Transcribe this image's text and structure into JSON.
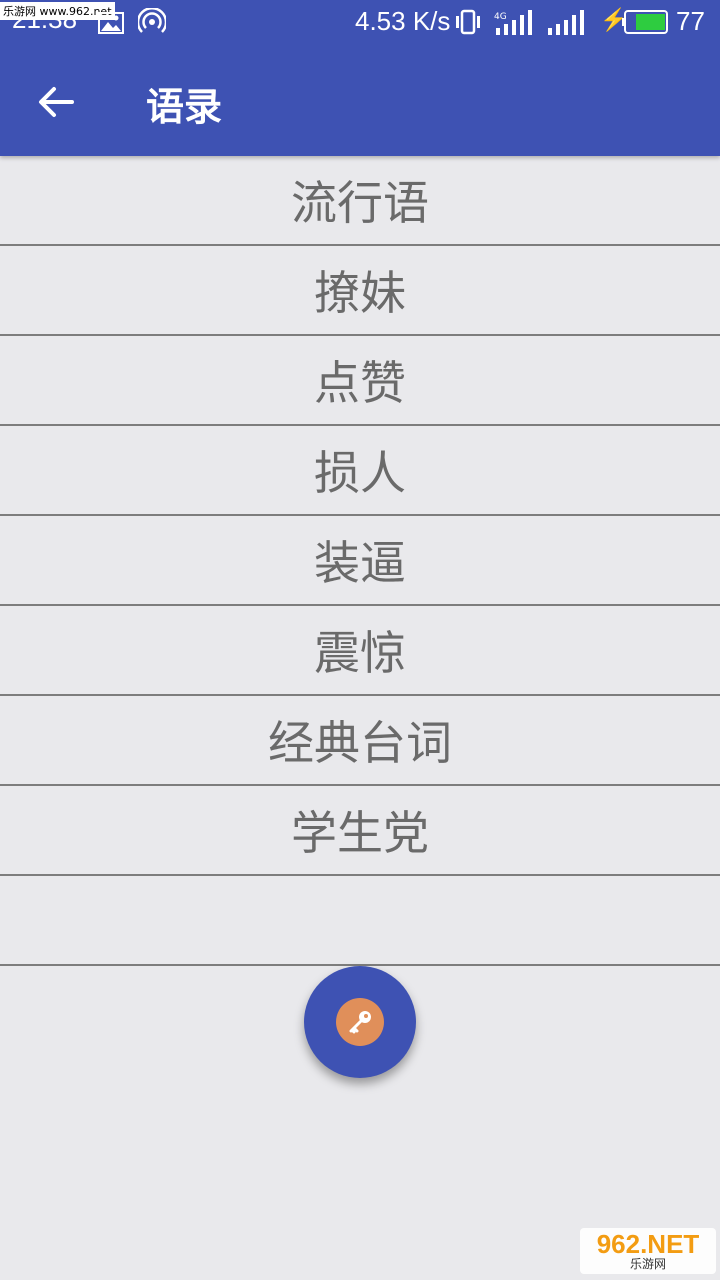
{
  "status_bar": {
    "time": "21:38",
    "watermark_top": "乐游网 www.962.net",
    "speed": "4.53 K/s",
    "network_type": "4G",
    "battery_level": "77",
    "colors": {
      "battery_fill": "#2ecc40"
    }
  },
  "app_bar": {
    "title": "语录",
    "back_icon": "arrow-left-icon",
    "colors": {
      "background": "#3e52b3"
    }
  },
  "list": {
    "items": [
      {
        "label": "流行语"
      },
      {
        "label": "撩妹"
      },
      {
        "label": "点赞"
      },
      {
        "label": "损人"
      },
      {
        "label": "装逼"
      },
      {
        "label": "震惊"
      },
      {
        "label": "经典台词"
      },
      {
        "label": "学生党"
      },
      {
        "label": ""
      }
    ]
  },
  "fab": {
    "icon": "key-icon",
    "colors": {
      "background": "#3e52b3",
      "inner": "#e08f5a"
    }
  },
  "watermark_bottom": {
    "brand": "962.NET",
    "text": "乐游网"
  }
}
